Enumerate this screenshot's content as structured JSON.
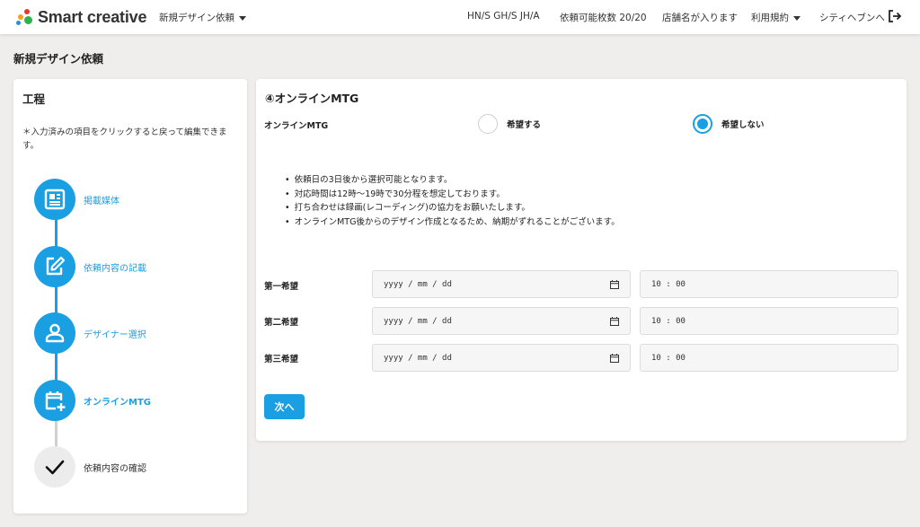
{
  "header": {
    "brand": "Smart creative",
    "nav_new_design": "新規デザイン依頼",
    "codes": "HN/S GH/S JH/A",
    "quota": "依頼可能枚数 20/20",
    "store": "店舗名が入ります",
    "terms": "利用規約",
    "user": "シティヘブンへ",
    "icons": {
      "logout": "logout-icon",
      "caret": "chevron-down-icon"
    }
  },
  "page": {
    "title": "新規デザイン依頼"
  },
  "sidebar": {
    "title": "工程",
    "note": "＊入力済みの項目をクリックすると戻って編集できます。",
    "steps": [
      {
        "label": "掲載媒体",
        "icon": "media-icon",
        "state": "completed"
      },
      {
        "label": "依頼内容の記載",
        "icon": "edit-icon",
        "state": "completed"
      },
      {
        "label": "デザイナー選択",
        "icon": "user-icon",
        "state": "completed"
      },
      {
        "label": "オンラインMTG",
        "icon": "calendar-add-icon",
        "state": "current"
      },
      {
        "label": "依頼内容の確認",
        "icon": "check-icon",
        "state": "pending"
      }
    ]
  },
  "main": {
    "section_title": "④オンラインMTG",
    "mtg_label": "オンラインMTG",
    "options": [
      {
        "label": "希望する",
        "selected": false
      },
      {
        "label": "希望しない",
        "selected": true
      }
    ],
    "notes": [
      "依頼日の3日後から選択可能となります。",
      "対応時間は12時〜19時で30分程を想定しております。",
      "打ち合わせは録画(レコーディング)の協力をお願いたします。",
      "オンラインMTG後からのデザイン作成となるため、納期がずれることがございます。"
    ],
    "preferences": [
      {
        "label": "第一希望",
        "date_placeholder": "yyyy / mm / dd",
        "time": "10 : 00"
      },
      {
        "label": "第二希望",
        "date_placeholder": "yyyy / mm / dd",
        "time": "10 : 00"
      },
      {
        "label": "第三希望",
        "date_placeholder": "yyyy / mm / dd",
        "time": "10 : 00"
      }
    ],
    "next_label": "次へ"
  },
  "colors": {
    "accent": "#1a9fe3",
    "background": "#efeeec"
  }
}
